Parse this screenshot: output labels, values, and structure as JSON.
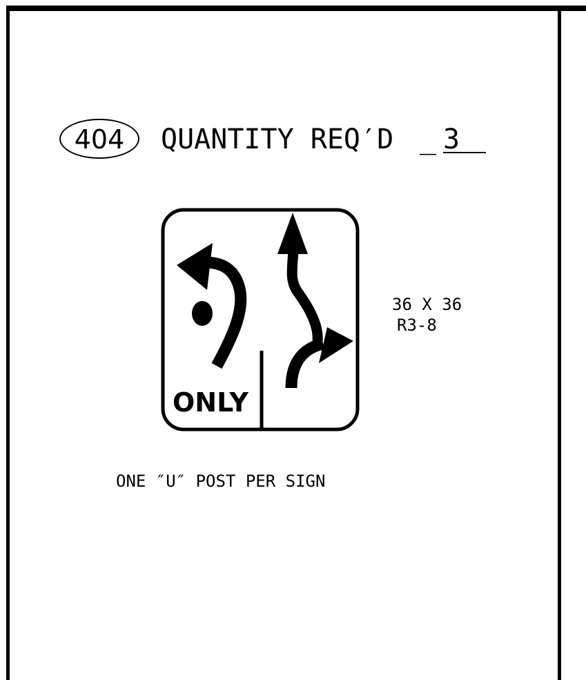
{
  "sign": {
    "number": "404",
    "quantity_label": "QUANTITY REQ′D",
    "quantity_blank": "_",
    "quantity_value": "3",
    "panel_legend": "ONLY",
    "size": "36 X 36",
    "code": "R3-8",
    "post_note": "ONE ″U″ POST PER SIGN"
  },
  "icons": {
    "left_arrow": "u-turn-arrow-icon",
    "right_arrow": "through-right-arrow-icon"
  }
}
